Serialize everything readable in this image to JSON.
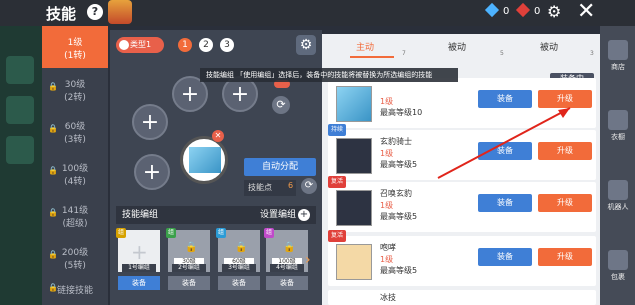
{
  "header": {
    "title": "技能",
    "help": "?",
    "gems": "0",
    "rubies": "0"
  },
  "left_tabs": [
    {
      "line1": "1级",
      "line2": "(1转)",
      "locked": false
    },
    {
      "line1": "30级",
      "line2": "(2转)",
      "locked": true
    },
    {
      "line1": "60级",
      "line2": "(3转)",
      "locked": true
    },
    {
      "line1": "100级",
      "line2": "(4转)",
      "locked": true
    },
    {
      "line1": "141级",
      "line2": "(超级)",
      "locked": true
    },
    {
      "line1": "200级",
      "line2": "(5转)",
      "locked": true
    },
    {
      "line1": "链接技能",
      "line2": "",
      "locked": true
    }
  ],
  "center": {
    "type_label": "类型1",
    "numbers": [
      "1",
      "2",
      "3"
    ],
    "auto_assign": "自动分配",
    "points_label": "技能点",
    "points_value": "6",
    "preset_title": "技能编组",
    "preset_set": "设置编组",
    "tooltip": "技能编组 「使用编组」选择后，装备中的技能将被替换为所选编组的技能"
  },
  "presets": [
    {
      "name": "1号编组",
      "level": "",
      "badge": "组",
      "button": "装备"
    },
    {
      "name": "2号编组",
      "level": "30级",
      "badge": "组",
      "button": "装备"
    },
    {
      "name": "3号编组",
      "level": "60级",
      "badge": "组",
      "button": "装备"
    },
    {
      "name": "4号编组",
      "level": "100级",
      "badge": "组",
      "button": "装备"
    }
  ],
  "right": {
    "tabs": [
      {
        "label": "主动",
        "count": "7"
      },
      {
        "label": "被动",
        "count": "5"
      },
      {
        "label": "被动",
        "count": "3"
      }
    ],
    "equipped_tag": "装备中",
    "rows": [
      {
        "name": "",
        "level": "1级",
        "min": "最高等级10",
        "tag": "",
        "equip": "装备",
        "upgrade": "升级"
      },
      {
        "name": "玄豹骑士",
        "level": "1级",
        "min": "最高等级5",
        "tag": "持续",
        "equip": "装备",
        "upgrade": "升级"
      },
      {
        "name": "召唤玄豹",
        "level": "1级",
        "min": "最高等级5",
        "tag": "复活",
        "equip": "装备",
        "upgrade": "升级"
      },
      {
        "name": "咆哮",
        "level": "1级",
        "min": "最高等级5",
        "tag": "复活",
        "equip": "装备",
        "upgrade": "升级"
      },
      {
        "name": "冰技",
        "level": "",
        "min": "",
        "tag": "",
        "equip": "",
        "upgrade": ""
      }
    ]
  },
  "far_right": [
    "商店",
    "衣橱",
    "机器人",
    "包裹"
  ],
  "colors": {
    "accent": "#f26b3a",
    "blue": "#3f7fd6"
  }
}
